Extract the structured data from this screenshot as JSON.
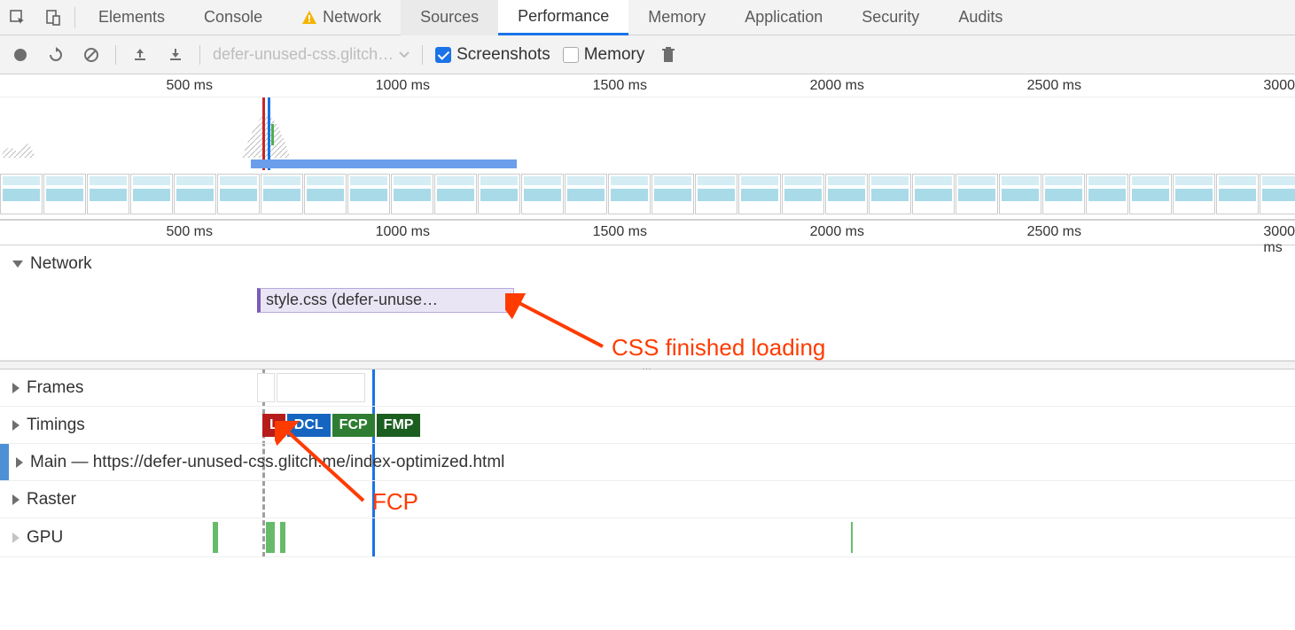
{
  "tabs": {
    "elements": "Elements",
    "console": "Console",
    "network": "Network",
    "sources": "Sources",
    "performance": "Performance",
    "memory": "Memory",
    "application": "Application",
    "security": "Security",
    "audits": "Audits"
  },
  "toolbar": {
    "dropdown_label": "defer-unused-css.glitch…",
    "screenshots_label": "Screenshots",
    "memory_label": "Memory"
  },
  "overview_ruler": {
    "t500": "500 ms",
    "t1000": "1000 ms",
    "t1500": "1500 ms",
    "t2000": "2000 ms",
    "t2500": "2500 ms",
    "t3000": "3000"
  },
  "detail_ruler": {
    "t500": "500 ms",
    "t1000": "1000 ms",
    "t1500": "1500 ms",
    "t2000": "2000 ms",
    "t2500": "2500 ms",
    "t3000": "3000 ms"
  },
  "tracks": {
    "network_label": "Network",
    "network_entry": "style.css (defer-unuse…",
    "frames_label": "Frames",
    "timings_label": "Timings",
    "main_label": "Main — https://defer-unused-css.glitch.me/index-optimized.html",
    "raster_label": "Raster",
    "gpu_label": "GPU"
  },
  "timing_badges": {
    "l": "L",
    "dcl": "DCL",
    "fcp": "FCP",
    "fmp": "FMP"
  },
  "annotations": {
    "css_finished": "CSS finished loading",
    "fcp": "FCP"
  },
  "divider_dots": "…"
}
